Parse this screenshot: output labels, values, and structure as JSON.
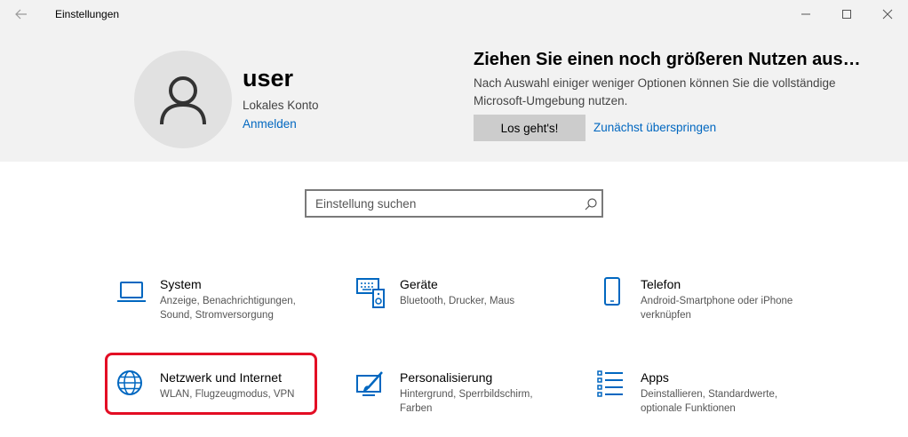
{
  "window": {
    "title": "Einstellungen",
    "back_icon": "back-arrow-icon",
    "controls": [
      "minimize-icon",
      "maximize-icon",
      "close-icon"
    ]
  },
  "account": {
    "name": "user",
    "type": "Lokales Konto",
    "sign_in_link": "Anmelden"
  },
  "promo": {
    "title": "Ziehen Sie einen noch größeren Nutzen aus…",
    "text": "Nach Auswahl einiger weniger Optionen können Sie die vollständige Microsoft-Umgebung nutzen.",
    "primary_button": "Los geht's!",
    "skip_link": "Zunächst überspringen"
  },
  "search": {
    "placeholder": "Einstellung suchen"
  },
  "categories": [
    {
      "title": "System",
      "description": "Anzeige, Benachrichtigungen, Sound, Stromversorgung",
      "icon": "laptop-icon"
    },
    {
      "title": "Geräte",
      "description": "Bluetooth, Drucker, Maus",
      "icon": "devices-icon"
    },
    {
      "title": "Telefon",
      "description": "Android-Smartphone oder iPhone verknüpfen",
      "icon": "phone-icon"
    },
    {
      "title": "Netzwerk und Internet",
      "description": "WLAN, Flugzeugmodus, VPN",
      "icon": "globe-icon"
    },
    {
      "title": "Personalisierung",
      "description": "Hintergrund, Sperrbildschirm, Farben",
      "icon": "personalization-icon"
    },
    {
      "title": "Apps",
      "description": "Deinstallieren, Standardwerte, optionale Funktionen",
      "icon": "apps-list-icon"
    }
  ],
  "colors": {
    "accent": "#0067c0",
    "highlight": "#e30d24",
    "header_bg": "#f2f2f2"
  }
}
